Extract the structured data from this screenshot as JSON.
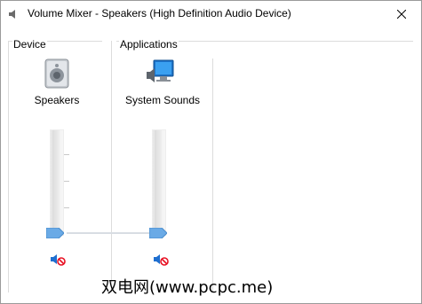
{
  "window": {
    "title": "Volume Mixer - Speakers (High Definition Audio Device)"
  },
  "device": {
    "group_label": "Device",
    "name": "Speakers",
    "volume_percent": 0,
    "muted": true
  },
  "applications": {
    "group_label": "Applications",
    "items": [
      {
        "name": "System Sounds",
        "volume_percent": 0,
        "muted": true
      }
    ]
  },
  "watermark": "双电网(www.pcpc.me)",
  "colors": {
    "accent": "#4a90d9",
    "thumb": "#5aa0e0",
    "mute_red": "#e81123"
  }
}
